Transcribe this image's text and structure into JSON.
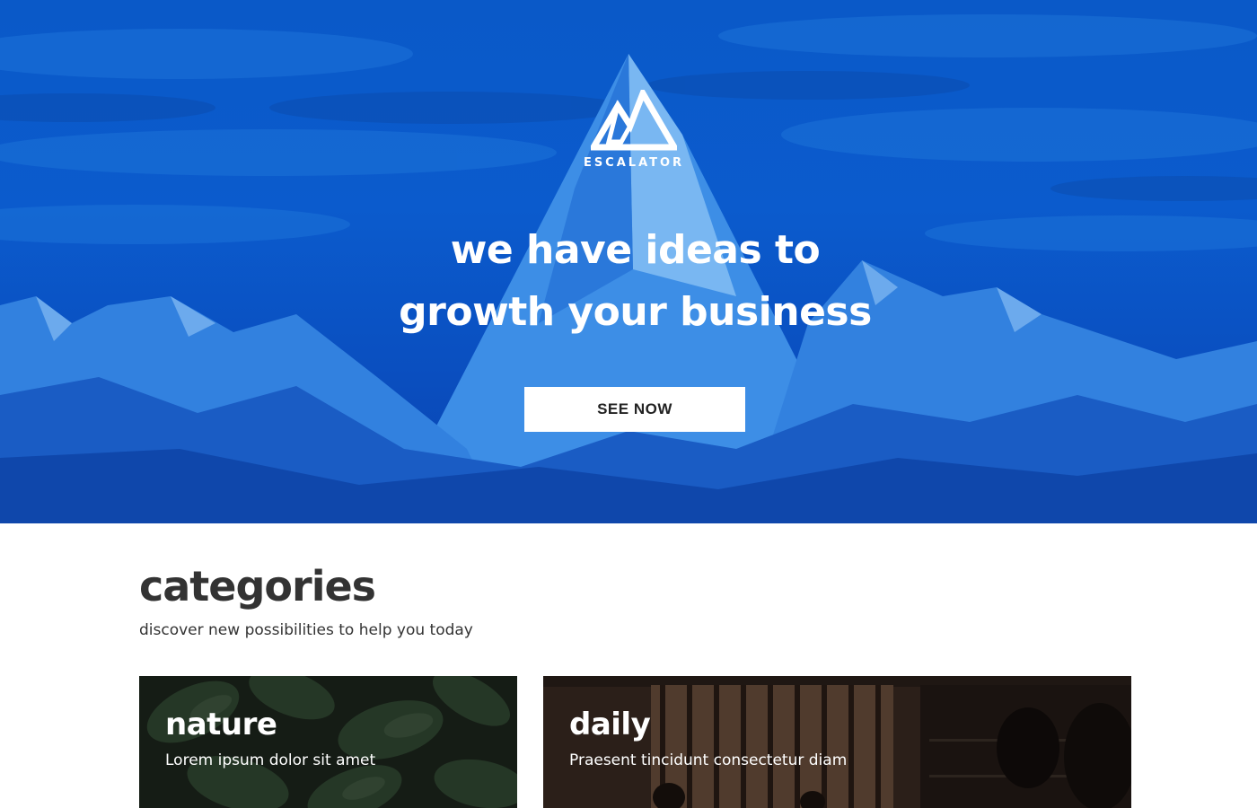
{
  "hero": {
    "logo_text": "ESCALATOR",
    "headline_line1": "we have ideas to",
    "headline_line2": "growth your business",
    "cta_label": "SEE NOW"
  },
  "categories": {
    "title": "categories",
    "subtitle": "discover new possibilities to help you today",
    "cards": [
      {
        "title": "nature",
        "description": "Lorem ipsum dolor sit amet"
      },
      {
        "title": "daily",
        "description": "Praesent tincidunt consectetur diam"
      }
    ]
  },
  "colors": {
    "hero_blue": "#0a59c8",
    "white": "#ffffff",
    "text_dark": "#333333"
  }
}
